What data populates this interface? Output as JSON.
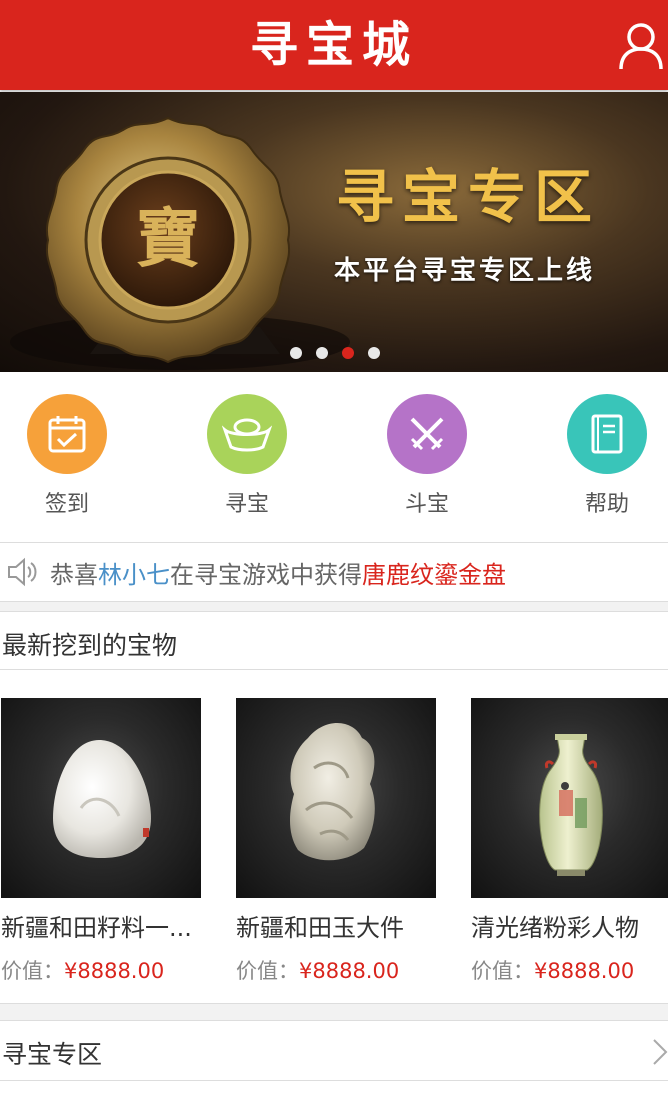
{
  "header": {
    "title": "寻宝城",
    "user_icon": "user-icon"
  },
  "banner": {
    "title": "寻宝专区",
    "subtitle": "本平台寻宝专区上线",
    "coin_text": "寶",
    "slides": 4,
    "active_slide": 3
  },
  "menu": {
    "items": [
      {
        "label": "签到",
        "icon": "calendar-check-icon",
        "color": "#f6a13a"
      },
      {
        "label": "寻宝",
        "icon": "gold-ingot-icon",
        "color": "#a9d35a"
      },
      {
        "label": "斗宝",
        "icon": "crossed-swords-icon",
        "color": "#b573c8"
      },
      {
        "label": "帮助",
        "icon": "book-icon",
        "color": "#39c5b9"
      }
    ]
  },
  "notice": {
    "icon": "speaker-icon",
    "prefix": "恭喜",
    "user": "林小七",
    "middle": "在寻宝游戏中获得",
    "item": "唐鹿纹鎏金盘"
  },
  "latest": {
    "title": "最新挖到的宝物",
    "price_label": "价值：",
    "products": [
      {
        "name": "新疆和田籽料一...",
        "price": "¥8888.00",
        "image": "white-jade-pebble"
      },
      {
        "name": "新疆和田玉大件",
        "price": "¥8888.00",
        "image": "jade-carving"
      },
      {
        "name": "清光绪粉彩人物",
        "price": "¥8888.00",
        "image": "famille-rose-vase"
      }
    ]
  },
  "zone": {
    "title": "寻宝专区",
    "icon": "chevron-right-icon"
  },
  "colors": {
    "brand_red": "#d9251d",
    "link_blue": "#4a90c8",
    "gold": "#f1c14a"
  }
}
